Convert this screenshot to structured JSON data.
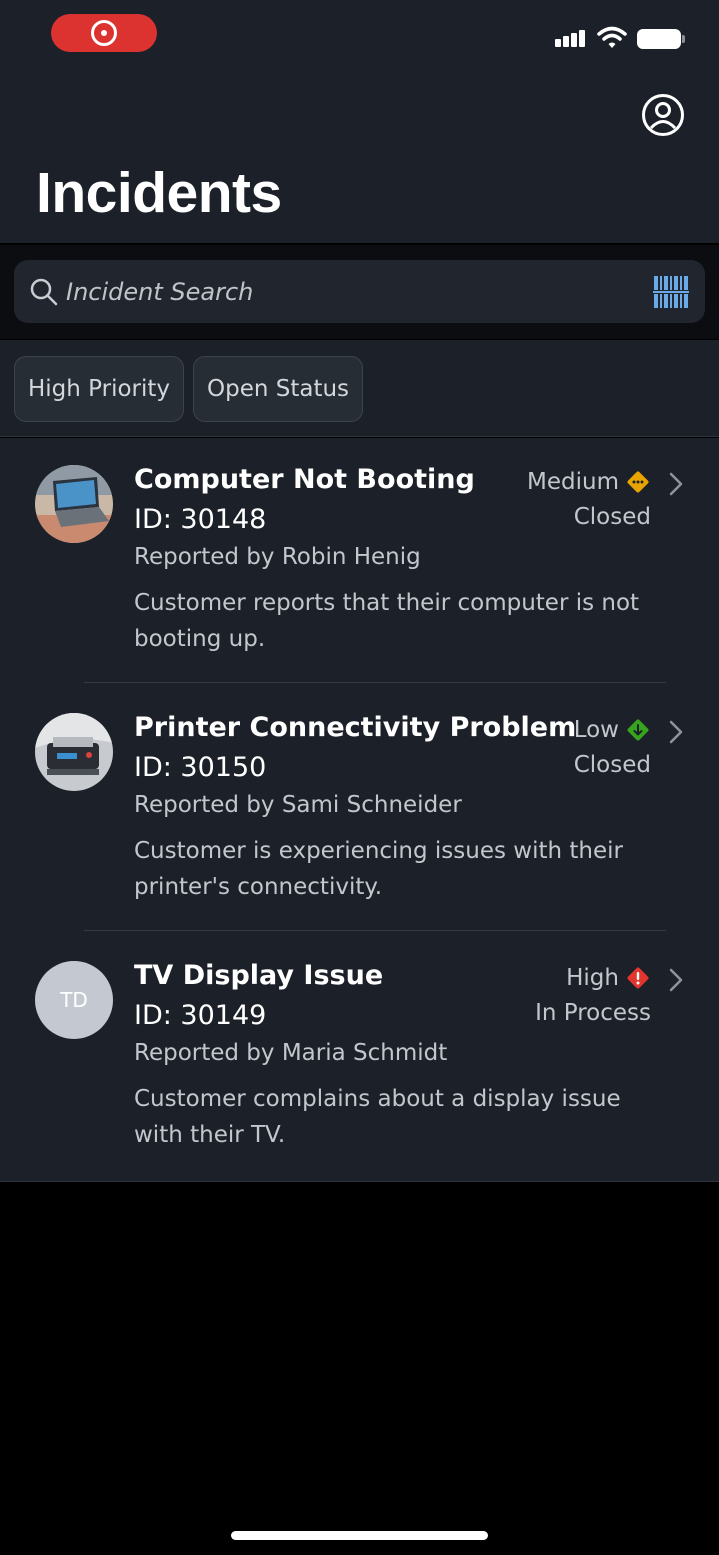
{
  "header": {
    "title": "Incidents",
    "profile_icon": "person-circle-icon"
  },
  "status_bar": {
    "recording_color": "#dc3330"
  },
  "search": {
    "placeholder": "Incident Search",
    "value": "",
    "scanner_icon": "barcode-icon"
  },
  "filters": [
    {
      "label": "High Priority"
    },
    {
      "label": "Open Status"
    }
  ],
  "incidents": [
    {
      "title": "Computer Not Booting",
      "id": "ID: 30148",
      "reporter": "Reported by Robin Henig",
      "description": "Customer reports that their computer is not booting up.",
      "priority": "Medium",
      "priority_icon": "warning-diamond-icon",
      "priority_color": "#e9a400",
      "status": "Closed",
      "avatar": "laptop-photo"
    },
    {
      "title": "Printer Connectivity Problem",
      "id": "ID: 30150",
      "reporter": "Reported by Sami Schneider",
      "description": "Customer is experiencing issues with their printer's connectivity.",
      "priority": "Low",
      "priority_icon": "down-arrow-diamond-icon",
      "priority_color": "#36a41d",
      "status": "Closed",
      "avatar": "printer-photo"
    },
    {
      "title": "TV Display Issue",
      "id": "ID: 30149",
      "reporter": "Reported by Maria Schmidt",
      "description": "Customer complains about a display issue with their TV.",
      "priority": "High",
      "priority_icon": "error-diamond-icon",
      "priority_color": "#e3342f",
      "status": "In Process",
      "avatar_initials": "TD"
    }
  ]
}
